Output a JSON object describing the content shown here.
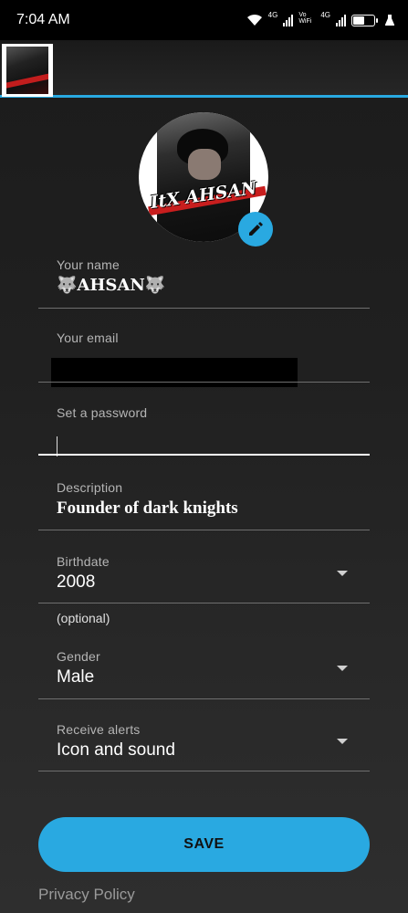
{
  "status_bar": {
    "time": "7:04 AM",
    "net1_label": "4G",
    "volte_label": "Vo WiFi",
    "net2_label": "4G",
    "battery_level": 0.55
  },
  "header": {
    "thumbnail_icon": "profile-thumbnail"
  },
  "avatar": {
    "overlay_text": "ItX AHSAN",
    "edit_icon": "pencil-icon"
  },
  "form": {
    "name": {
      "label": "Your name",
      "value": "🐺AHSAN🐺"
    },
    "email": {
      "label": "Your email",
      "value": ""
    },
    "password": {
      "label": "Set a password",
      "value": ""
    },
    "description": {
      "label": "Description",
      "value": "Founder of dark knights"
    },
    "birthdate": {
      "label": "Birthdate",
      "value": "2008",
      "helper": "(optional)"
    },
    "gender": {
      "label": "Gender",
      "value": "Male"
    },
    "alerts": {
      "label": "Receive alerts",
      "value": "Icon and sound"
    }
  },
  "actions": {
    "save_label": "SAVE",
    "privacy_label": "Privacy Policy"
  },
  "colors": {
    "accent": "#29a9e1",
    "background": "#202020",
    "underline": "#6e6e6e"
  }
}
